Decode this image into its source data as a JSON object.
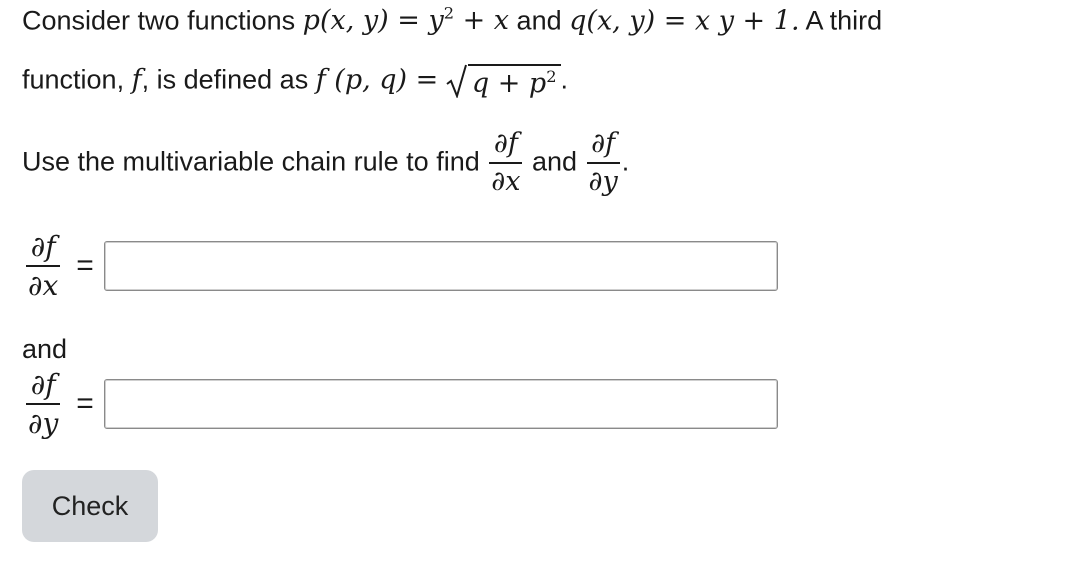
{
  "question": {
    "intro": "Consider two functions",
    "p_func": "p(x, y) = y",
    "p_rest": " + x",
    "and1": "and",
    "q_func": "q(x, y) = x y + 1.",
    "a_third": "A third",
    "line2_text": "function,",
    "f_symbol": "f",
    "line2_mid": ", is defined as",
    "f_def": "f (p, q) =",
    "radicand": "q + p",
    "superscript": "2",
    "period": ".",
    "use_text": "Use the multivariable chain rule to find",
    "df": "∂f",
    "dx": "∂x",
    "dy": "∂y",
    "and2": "and",
    "dot": "."
  },
  "answers": [
    {
      "numerator": "∂f",
      "denominator": "∂x",
      "equals": "=",
      "value": ""
    },
    {
      "numerator": "∂f",
      "denominator": "∂y",
      "equals": "=",
      "value": ""
    }
  ],
  "and_label": "and",
  "check_label": "Check"
}
